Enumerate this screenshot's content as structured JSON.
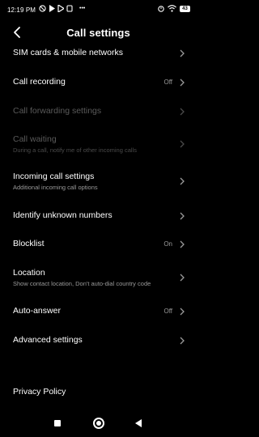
{
  "status": {
    "time": "12:19 PM",
    "more": "•••",
    "battery": "43"
  },
  "header": {
    "title": "Call settings"
  },
  "items": [
    {
      "label": "SIM cards & mobile networks",
      "sub": "",
      "value": ""
    },
    {
      "label": "Call recording",
      "sub": "",
      "value": "Off"
    },
    {
      "label": "Call forwarding settings",
      "sub": "",
      "value": ""
    },
    {
      "label": "Call waiting",
      "sub": "During a call, notify me of other incoming calls",
      "value": ""
    },
    {
      "label": "Incoming call settings",
      "sub": "Additional incoming call options",
      "value": ""
    },
    {
      "label": "Identify unknown numbers",
      "sub": "",
      "value": ""
    },
    {
      "label": "Blocklist",
      "sub": "",
      "value": "On"
    },
    {
      "label": "Location",
      "sub": "Show contact location, Don't auto-dial country code",
      "value": ""
    },
    {
      "label": "Auto-answer",
      "sub": "",
      "value": "Off"
    },
    {
      "label": "Advanced settings",
      "sub": "",
      "value": ""
    },
    {
      "label": "Privacy Policy",
      "sub": "",
      "value": ""
    }
  ]
}
